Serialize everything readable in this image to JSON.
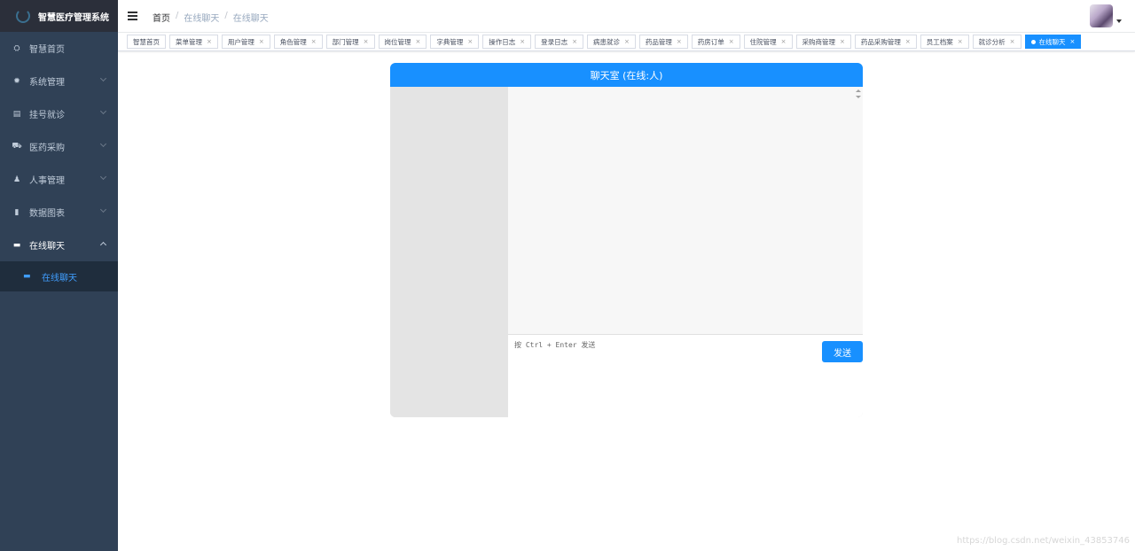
{
  "sidebar": {
    "title": "智慧医疗管理系统",
    "items": [
      {
        "label": "智慧首页",
        "icon": "dashboard-icon",
        "glyph": "⛭"
      },
      {
        "label": "系统管理",
        "icon": "gear-icon",
        "glyph": "✹"
      },
      {
        "label": "挂号就诊",
        "icon": "document-icon",
        "glyph": "▤"
      },
      {
        "label": "医药采购",
        "icon": "cart-icon",
        "glyph": "⛟"
      },
      {
        "label": "人事管理",
        "icon": "people-icon",
        "glyph": "♟"
      },
      {
        "label": "数据图表",
        "icon": "bar-chart-icon",
        "glyph": "▮"
      },
      {
        "label": "在线聊天",
        "icon": "chat-icon",
        "glyph": "▬"
      }
    ],
    "sub_item": {
      "label": "在线聊天",
      "icon": "chat-icon",
      "glyph": "▬"
    }
  },
  "topbar": {
    "breadcrumb": [
      "首页",
      "在线聊天",
      "在线聊天"
    ],
    "separator": "/"
  },
  "tags": [
    {
      "label": "智慧首页",
      "closable": false
    },
    {
      "label": "菜单管理",
      "closable": true
    },
    {
      "label": "用户管理",
      "closable": true
    },
    {
      "label": "角色管理",
      "closable": true
    },
    {
      "label": "部门管理",
      "closable": true
    },
    {
      "label": "岗位管理",
      "closable": true
    },
    {
      "label": "字典管理",
      "closable": true
    },
    {
      "label": "操作日志",
      "closable": true
    },
    {
      "label": "登录日志",
      "closable": true
    },
    {
      "label": "病患就诊",
      "closable": true
    },
    {
      "label": "药品管理",
      "closable": true
    },
    {
      "label": "药房订单",
      "closable": true
    },
    {
      "label": "住院管理",
      "closable": true
    },
    {
      "label": "采购商管理",
      "closable": true
    },
    {
      "label": "药品采购管理",
      "closable": true
    },
    {
      "label": "员工档案",
      "closable": true
    },
    {
      "label": "就诊分析",
      "closable": true
    },
    {
      "label": "在线聊天",
      "closable": true,
      "active": true
    }
  ],
  "close_glyph": "×",
  "chat": {
    "title": "聊天室 (在线:人)",
    "input_placeholder": "按 Ctrl + Enter 发送",
    "send_label": "发送"
  },
  "watermark": "https://blog.csdn.net/weixin_43853746",
  "colors": {
    "accent": "#1890ff",
    "sidebar_bg": "#304156",
    "sidebar_text": "#bfcbd9"
  }
}
